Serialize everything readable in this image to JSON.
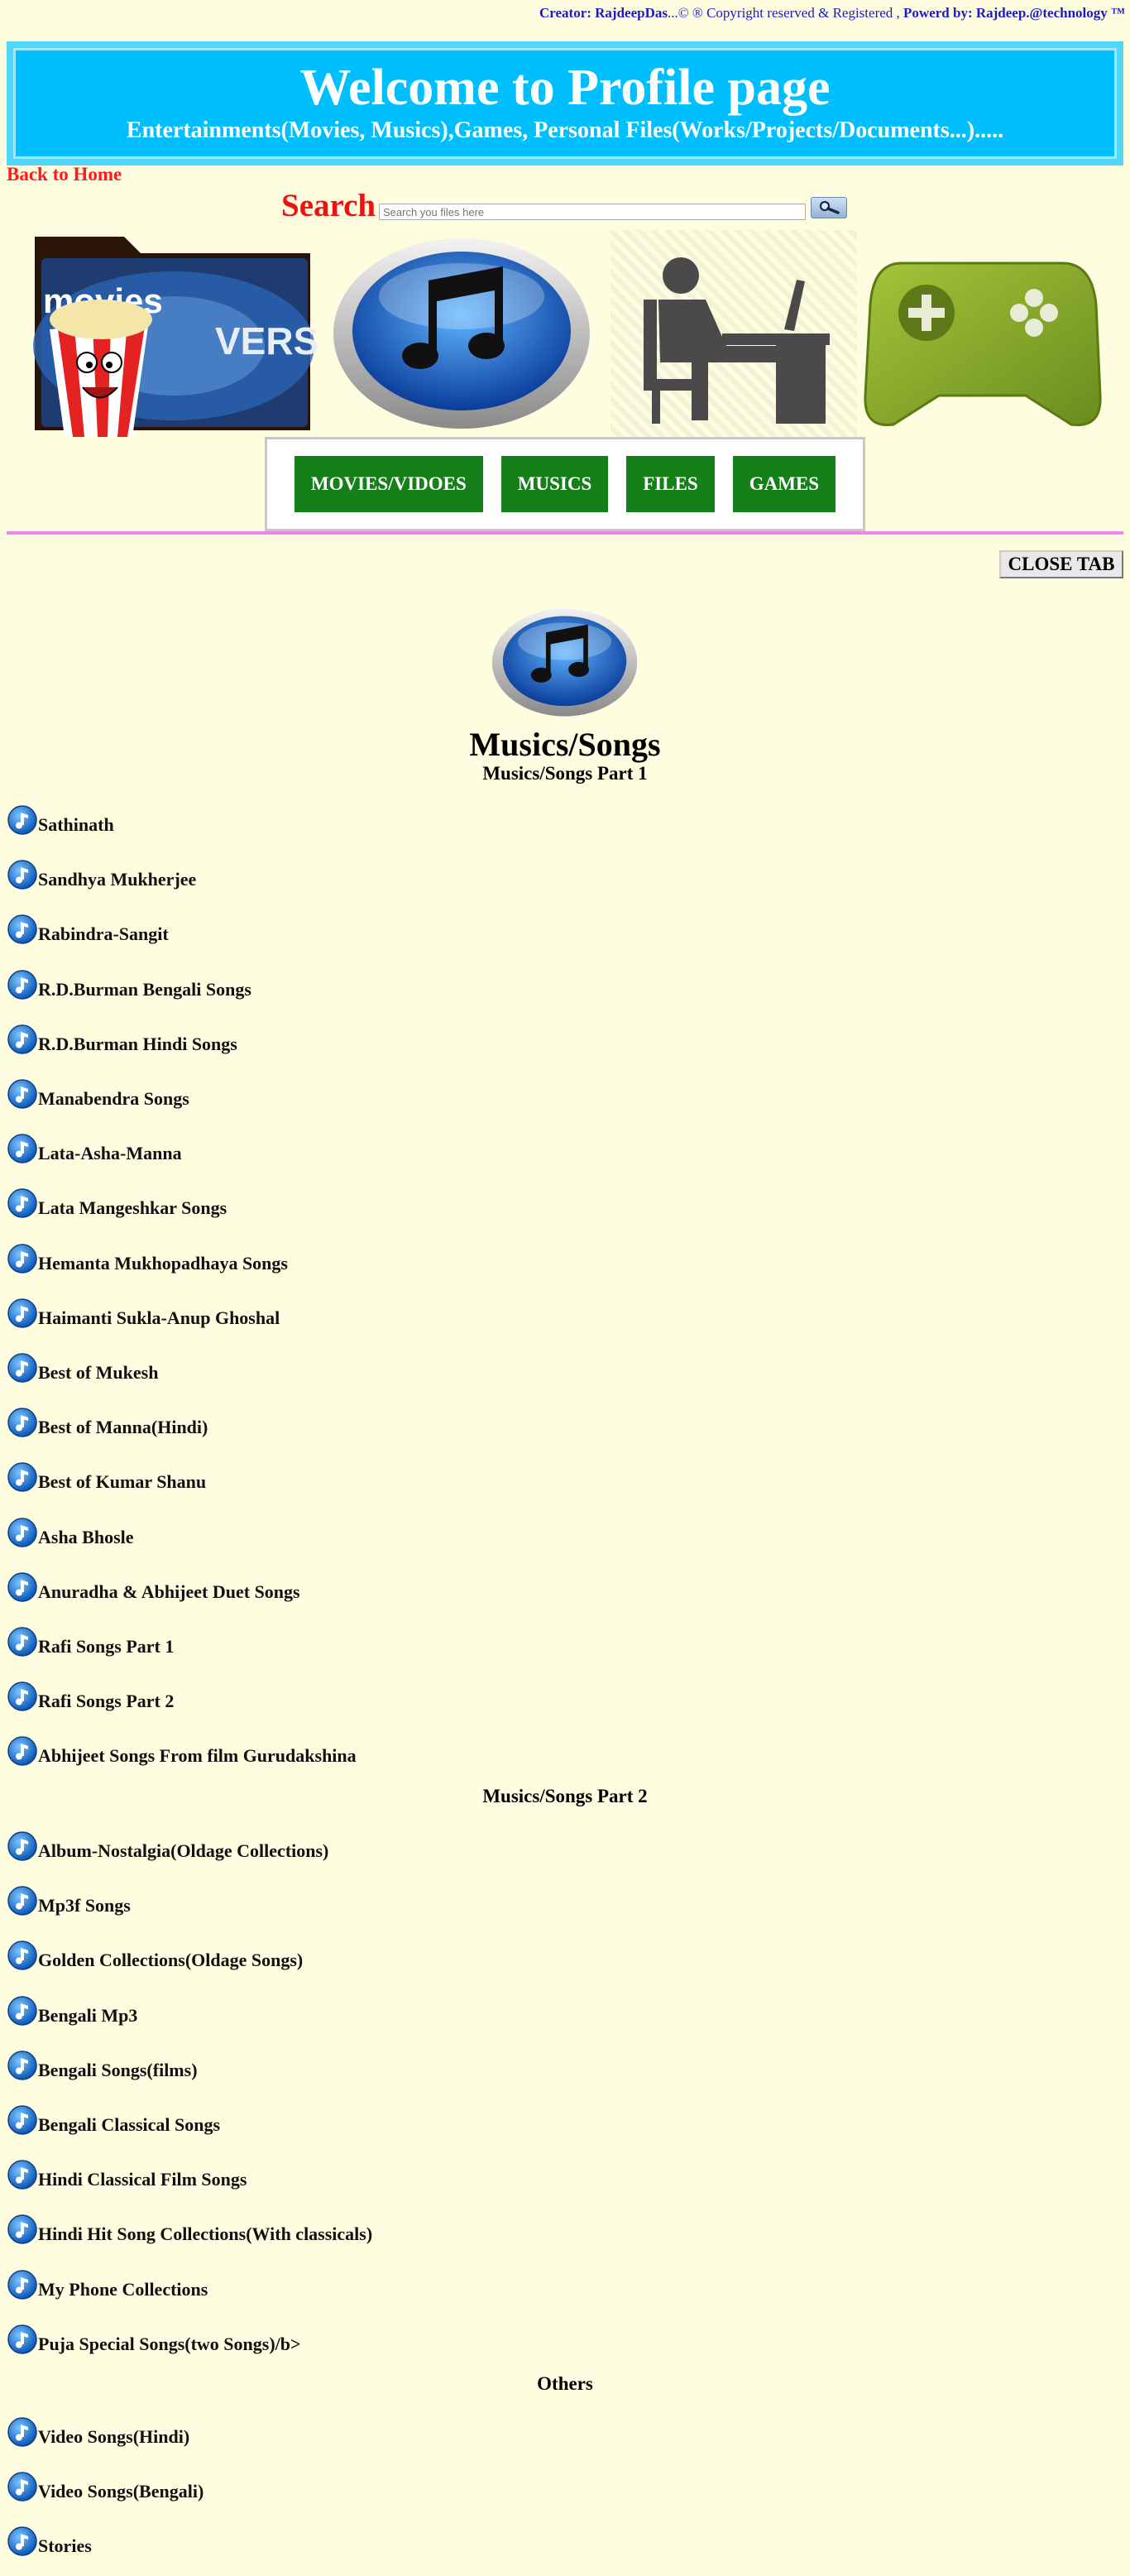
{
  "header": {
    "creator_label": "Creator:",
    "creator_name": "RajdeepDas",
    "copyright": "...© ® Copyright reserved & Registered ,",
    "powered_label": "Powerd by:",
    "powered_name": "Rajdeep.@technology ™"
  },
  "banner": {
    "title": "Welcome to Profile page",
    "subtitle": "Entertainments(Movies, Musics),Games, Personal Files(Works/Projects/Documents...)....."
  },
  "nav": {
    "back_home": "Back to Home"
  },
  "search": {
    "label": "Search",
    "placeholder": "Search you files here",
    "icon": "magnifier-icon"
  },
  "tiles": [
    {
      "name": "movies",
      "text": "movies",
      "overlay": "VERSAL"
    },
    {
      "name": "music"
    },
    {
      "name": "files"
    },
    {
      "name": "games"
    }
  ],
  "categories": [
    "MOVIES/VIDOES",
    "MUSICS",
    "FILES",
    "GAMES"
  ],
  "close_tab": "CLOSE TAB",
  "content": {
    "title": "Musics/Songs",
    "part1": {
      "heading": "Musics/Songs Part 1",
      "items": [
        "Sathinath",
        "Sandhya Mukherjee",
        "Rabindra-Sangit",
        "R.D.Burman Bengali Songs",
        "R.D.Burman Hindi Songs",
        "Manabendra Songs",
        "Lata-Asha-Manna",
        "Lata Mangeshkar Songs",
        "Hemanta Mukhopadhaya Songs",
        "Haimanti Sukla-Anup Ghoshal",
        "Best of Mukesh",
        "Best of Manna(Hindi)",
        "Best of Kumar Shanu",
        "Asha Bhosle",
        "Anuradha & Abhijeet Duet Songs",
        "Rafi Songs Part 1",
        "Rafi Songs Part 2",
        "Abhijeet Songs From film Gurudakshina"
      ]
    },
    "part2": {
      "heading": "Musics/Songs Part 2",
      "items": [
        "Album-Nostalgia(Oldage Collections)",
        "Mp3f Songs",
        "Golden Collections(Oldage Songs)",
        "Bengali Mp3",
        "Bengali Songs(films)",
        "Bengali Classical Songs",
        "Hindi Classical Film Songs",
        "Hindi Hit Song Collections(With classicals)",
        "My Phone Collections",
        "Puja Special Songs(two Songs)/b>"
      ]
    },
    "others": {
      "heading": "Others",
      "items": [
        "Video Songs(Hindi)",
        "Video Songs(Bengali)",
        "Stories"
      ]
    }
  },
  "colors": {
    "background": "#fffde0",
    "banner": "#00bfff",
    "category_button": "#157f1a",
    "link_red": "#ff1a1a",
    "credit_blue": "#1a1acc",
    "divider": "#ee82ee"
  }
}
